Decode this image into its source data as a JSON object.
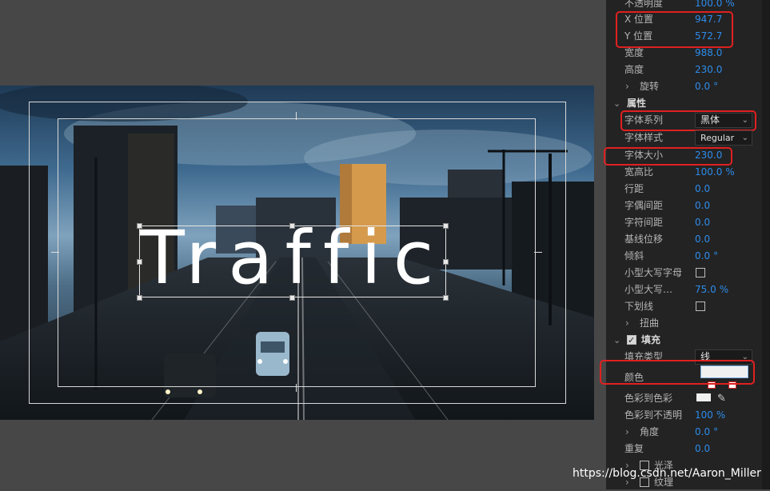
{
  "canvas": {
    "title_text": "Traffic"
  },
  "panel": {
    "opacity": {
      "label": "不透明度",
      "value": "100.0",
      "unit": "%"
    },
    "x_pos": {
      "label": "X 位置",
      "value": "947.7"
    },
    "y_pos": {
      "label": "Y 位置",
      "value": "572.7"
    },
    "width": {
      "label": "宽度",
      "value": "988.0"
    },
    "height": {
      "label": "高度",
      "value": "230.0"
    },
    "rotation": {
      "label": "旋转",
      "value": "0.0",
      "unit": "°"
    },
    "attributes": {
      "label": "属性"
    },
    "font_family": {
      "label": "字体系列",
      "value": "黑体"
    },
    "font_style": {
      "label": "字体样式",
      "value": "Regular"
    },
    "font_size": {
      "label": "字体大小",
      "value": "230.0"
    },
    "aspect": {
      "label": "宽高比",
      "value": "100.0",
      "unit": "%"
    },
    "leading": {
      "label": "行距",
      "value": "0.0"
    },
    "kerning": {
      "label": "字偶间距",
      "value": "0.0"
    },
    "tracking": {
      "label": "字符间距",
      "value": "0.0"
    },
    "baseline": {
      "label": "基线位移",
      "value": "0.0"
    },
    "tilt": {
      "label": "倾斜",
      "value": "0.0",
      "unit": "°"
    },
    "small_caps": {
      "label": "小型大写字母",
      "checked": false
    },
    "small_caps_size": {
      "label": "小型大写…",
      "value": "75.0",
      "unit": "%"
    },
    "underline": {
      "label": "下划线",
      "checked": false
    },
    "distort": {
      "label": "扭曲"
    },
    "fill": {
      "label": "填充",
      "checked": true
    },
    "fill_type": {
      "label": "填充类型",
      "value": "线"
    },
    "color": {
      "label": "颜色",
      "swatch": "#f0f0f0"
    },
    "color_to_color": {
      "label": "色彩到色彩"
    },
    "color_to_opacity": {
      "label": "色彩到不透明",
      "value": "100",
      "unit": "%"
    },
    "angle": {
      "label": "角度",
      "value": "0.0",
      "unit": "°"
    },
    "repeat": {
      "label": "重复",
      "value": "0.0"
    },
    "sheen": {
      "label": "光泽",
      "checked": false
    },
    "texture": {
      "label": "纹理",
      "checked": false
    }
  },
  "watermark": "https://blog.csdn.net/Aaron_Miller",
  "colors": {
    "accent": "#2d8ceb",
    "highlight": "#e02020",
    "panel_bg": "#232323",
    "viewer_bg": "#474747"
  }
}
